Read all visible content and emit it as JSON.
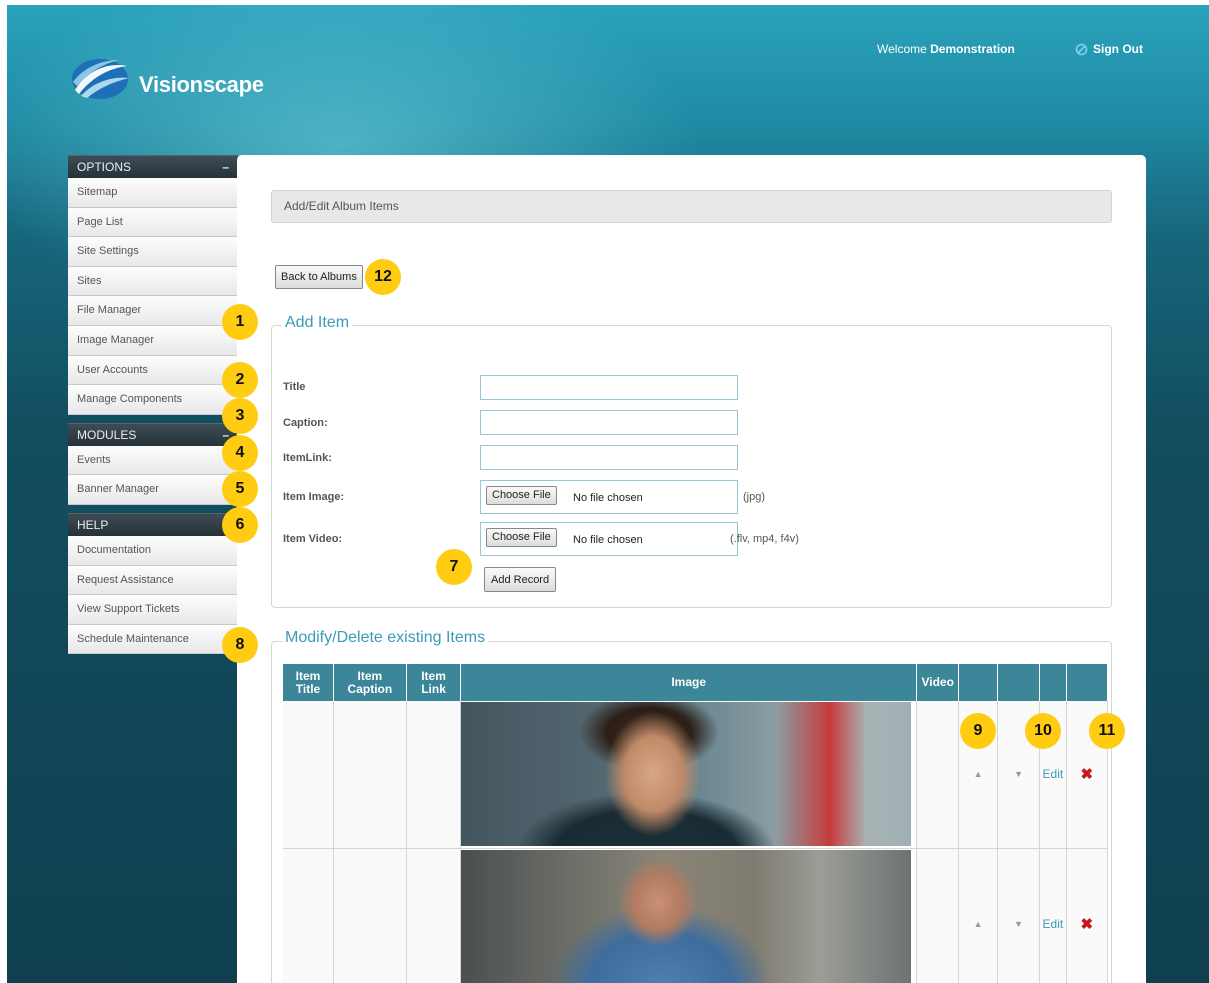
{
  "brand": {
    "name": "Visionscape",
    "logo_icon": "swoosh-logo-icon"
  },
  "header": {
    "welcome_prefix": "Welcome",
    "user_name": "Demonstration",
    "sign_out_label": "Sign Out",
    "sign_out_icon": "circle-slash-icon"
  },
  "sidebar": {
    "options": {
      "title": "OPTIONS",
      "toggle": "–",
      "items": [
        "Sitemap",
        "Page List",
        "Site Settings",
        "Sites",
        "File Manager",
        "Image Manager",
        "User Accounts",
        "Manage Components"
      ]
    },
    "modules": {
      "title": "MODULES",
      "toggle": "–",
      "items": [
        "Events",
        "Banner Manager"
      ]
    },
    "help": {
      "title": "HELP",
      "toggle": "–",
      "items": [
        "Documentation",
        "Request Assistance",
        "View Support Tickets",
        "Schedule Maintenance"
      ]
    }
  },
  "main": {
    "page_title": "Add/Edit Album Items",
    "back_button": "Back to Albums",
    "add_item": {
      "legend": "Add Item",
      "title_label": "Title",
      "caption_label": "Caption:",
      "itemlink_label": "ItemLink:",
      "image_label": "Item Image:",
      "video_label": "Item Video:",
      "choose_file": "Choose File",
      "no_file": "No file chosen",
      "image_hint": "(jpg)",
      "video_hint": "(.flv, mp4, f4v)",
      "title_value": "",
      "caption_value": "",
      "itemlink_value": "",
      "add_button": "Add Record"
    },
    "existing": {
      "legend": "Modify/Delete existing Items",
      "columns": {
        "item_title_1": "Item",
        "item_title_2": "Title",
        "item_caption_1": "Item",
        "item_caption_2": "Caption",
        "item_link_1": "Item",
        "item_link_2": "Link",
        "image": "Image",
        "video": "Video"
      },
      "rows": [
        {
          "up_icon": "▲",
          "down_icon": "▼",
          "edit": "Edit",
          "delete": "✖"
        },
        {
          "up_icon": "▲",
          "down_icon": "▼",
          "edit": "Edit",
          "delete": "✖"
        }
      ]
    }
  },
  "callouts": {
    "c1": "1",
    "c2": "2",
    "c3": "3",
    "c4": "4",
    "c5": "5",
    "c6": "6",
    "c7": "7",
    "c8": "8",
    "c9": "9",
    "c10": "10",
    "c11": "11",
    "c12": "12"
  },
  "colors": {
    "accent": "#3b9ab9",
    "table_header": "#3c8699",
    "callout": "#ffcc12",
    "delete": "#c8161d"
  }
}
